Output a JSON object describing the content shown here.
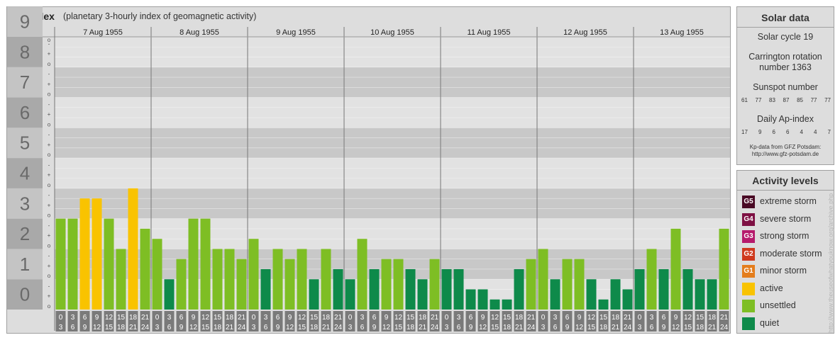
{
  "header": {
    "title": "Kp-index",
    "subtitle": "(planetary 3-hourly index of geomagnetic activity)"
  },
  "chart_data": {
    "type": "bar",
    "title": "Kp-index",
    "subtitle": "(planetary 3-hourly index of geomagnetic activity)",
    "ylim": [
      0,
      9
    ],
    "y_major_ticks": [
      "0",
      "1",
      "2",
      "3",
      "4",
      "5",
      "6",
      "7",
      "8",
      "9"
    ],
    "y_minor_ticks": [
      "o",
      "+",
      "-"
    ],
    "days": [
      "7 Aug 1955",
      "8 Aug 1955",
      "9 Aug 1955",
      "10 Aug 1955",
      "11 Aug 1955",
      "12 Aug 1955",
      "13 Aug 1955"
    ],
    "interval_top": [
      "0",
      "3",
      "6",
      "9",
      "12",
      "15",
      "18",
      "21"
    ],
    "interval_bottom": [
      "3",
      "6",
      "9",
      "12",
      "15",
      "18",
      "21",
      "24"
    ],
    "values": [
      3.0,
      3.0,
      3.667,
      3.667,
      3.0,
      2.0,
      4.0,
      2.667,
      2.333,
      1.0,
      1.667,
      3.0,
      3.0,
      2.0,
      2.0,
      1.667,
      2.333,
      1.333,
      2.0,
      1.667,
      2.0,
      1.0,
      2.0,
      1.333,
      1.0,
      2.333,
      1.333,
      1.667,
      1.667,
      1.333,
      1.0,
      1.667,
      1.333,
      1.333,
      0.667,
      0.667,
      0.333,
      0.333,
      1.333,
      1.667,
      2.0,
      1.0,
      1.667,
      1.667,
      1.0,
      0.333,
      1.0,
      0.667,
      1.333,
      2.0,
      1.333,
      2.667,
      1.333,
      1.0,
      1.0,
      2.667
    ],
    "levels": [
      "unsettled",
      "unsettled",
      "active",
      "active",
      "unsettled",
      "unsettled",
      "active",
      "unsettled",
      "unsettled",
      "quiet",
      "unsettled",
      "unsettled",
      "unsettled",
      "unsettled",
      "unsettled",
      "unsettled",
      "unsettled",
      "quiet",
      "unsettled",
      "unsettled",
      "unsettled",
      "quiet",
      "unsettled",
      "quiet",
      "quiet",
      "unsettled",
      "quiet",
      "unsettled",
      "unsettled",
      "quiet",
      "quiet",
      "unsettled",
      "quiet",
      "quiet",
      "quiet",
      "quiet",
      "quiet",
      "quiet",
      "quiet",
      "unsettled",
      "unsettled",
      "quiet",
      "unsettled",
      "unsettled",
      "quiet",
      "quiet",
      "quiet",
      "quiet",
      "quiet",
      "unsettled",
      "quiet",
      "unsettled",
      "quiet",
      "quiet",
      "quiet",
      "unsettled"
    ]
  },
  "solar_data": {
    "title": "Solar data",
    "solar_cycle": "Solar cycle 19",
    "carrington_line1": "Carrington rotation",
    "carrington_line2": "number 1363",
    "sunspot_title": "Sunspot number",
    "sunspot_values": [
      "61",
      "77",
      "83",
      "87",
      "85",
      "77",
      "77"
    ],
    "ap_title": "Daily Ap-index",
    "ap_values": [
      "17",
      "9",
      "6",
      "6",
      "4",
      "4",
      "7"
    ],
    "source_line1": "Kp-data from GFZ Potsdam:",
    "source_line2": "http://www.gfz-potsdam.de"
  },
  "activity_levels": {
    "title": "Activity levels",
    "items": [
      {
        "code": "G5",
        "label": "extreme storm",
        "color": "#4a0a25"
      },
      {
        "code": "G4",
        "label": "severe storm",
        "color": "#7e1043"
      },
      {
        "code": "G3",
        "label": "strong storm",
        "color": "#b61a6c"
      },
      {
        "code": "G2",
        "label": "moderate storm",
        "color": "#cf3a1e"
      },
      {
        "code": "G1",
        "label": "minor storm",
        "color": "#e47d1c"
      },
      {
        "code": "",
        "label": "active",
        "color": "#f9c300"
      },
      {
        "code": "",
        "label": "unsettled",
        "color": "#7ebe24"
      },
      {
        "code": "",
        "label": "quiet",
        "color": "#0e8a4a"
      }
    ]
  },
  "colors": {
    "active": "#f9c300",
    "unsettled": "#7ebe24",
    "quiet": "#0e8a4a",
    "band_dark": "#c8c8c8",
    "band_light": "#e2e2e2",
    "axis_dark": "#a9a9a9",
    "axis_light": "#c4c4c4",
    "interval_box": "#7a7a7a"
  },
  "watermark": "http://www.theuseofwhatyouknow.org/archive.php"
}
